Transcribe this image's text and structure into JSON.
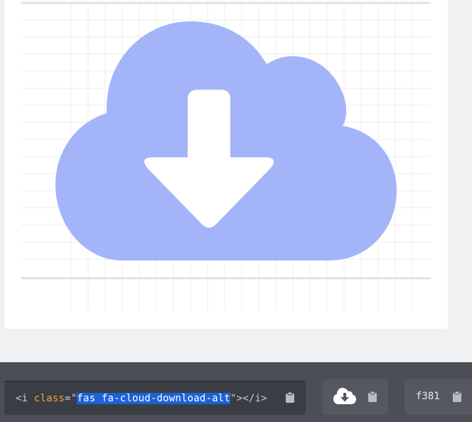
{
  "preview": {
    "icon": "cloud-download-alt-icon",
    "icon_color": "#a4b4f9",
    "arrow_color": "#ffffff",
    "grid_color": "#ececec"
  },
  "snippet": {
    "tag_open": "<i ",
    "attr_name": "class",
    "equals": "=",
    "quote_open": "\"",
    "class_value": "fas fa-cloud-download-alt",
    "quote_close": "\"",
    "tag_close": "></i>",
    "copy_icon": "clipboard-icon"
  },
  "glyph_box": {
    "icon": "cloud-download-alt-icon",
    "copy_icon": "clipboard-icon"
  },
  "unicode_box": {
    "value": "f381",
    "copy_icon": "clipboard-icon"
  },
  "colors": {
    "toolbar_bg": "#4b4e55",
    "code_bg": "#3a3d44",
    "selection": "#1d62d6",
    "attr": "#f0a24a"
  }
}
